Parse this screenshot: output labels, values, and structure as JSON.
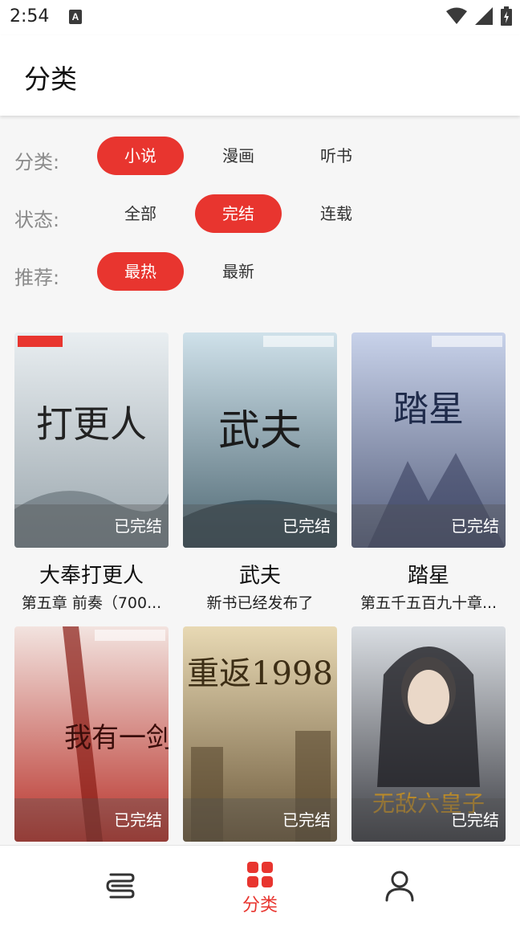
{
  "status_bar": {
    "time": "2:54",
    "notif_letter": "A"
  },
  "app_bar": {
    "title": "分类"
  },
  "filters": {
    "category": {
      "label": "分类:",
      "options": [
        "小说",
        "漫画",
        "听书"
      ],
      "selected": "小说"
    },
    "status": {
      "label": "状态:",
      "options": [
        "全部",
        "完结",
        "连载"
      ],
      "selected": "完结"
    },
    "sort": {
      "label": "推荐:",
      "options": [
        "最热",
        "最新"
      ],
      "selected": "最热"
    }
  },
  "books": [
    {
      "title": "大奉打更人",
      "latest": "第五章 前奏（700...",
      "badge": "已完结",
      "cover_text": "打更人",
      "cover_colors": [
        "#e9eef1",
        "#9aa6ad"
      ]
    },
    {
      "title": "武夫",
      "latest": "新书已经发布了",
      "badge": "已完结",
      "cover_text": "武夫",
      "cover_colors": [
        "#cfe1ea",
        "#4f6873"
      ]
    },
    {
      "title": "踏星",
      "latest": "第五千五百九十章...",
      "badge": "已完结",
      "cover_text": "踏星",
      "cover_colors": [
        "#c8d2ea",
        "#57607d"
      ]
    },
    {
      "title": "",
      "latest": "",
      "badge": "已完结",
      "cover_text": "我有一剑",
      "cover_colors": [
        "#f2e3df",
        "#b8322a"
      ]
    },
    {
      "title": "",
      "latest": "",
      "badge": "已完结",
      "cover_text": "重返1998",
      "cover_colors": [
        "#e8d9b4",
        "#6d5a3c"
      ]
    },
    {
      "title": "",
      "latest": "",
      "badge": "已完结",
      "cover_text": "无敌六皇子",
      "cover_colors": [
        "#d9dde2",
        "#3e3f45"
      ]
    }
  ],
  "bottom_nav": {
    "items": [
      {
        "name": "bookshelf",
        "label": ""
      },
      {
        "name": "category",
        "label": "分类"
      },
      {
        "name": "profile",
        "label": ""
      }
    ],
    "active_color": "#e8352f",
    "inactive_color": "#333333"
  },
  "colors": {
    "accent": "#e8352f",
    "background": "#f6f6f6"
  }
}
